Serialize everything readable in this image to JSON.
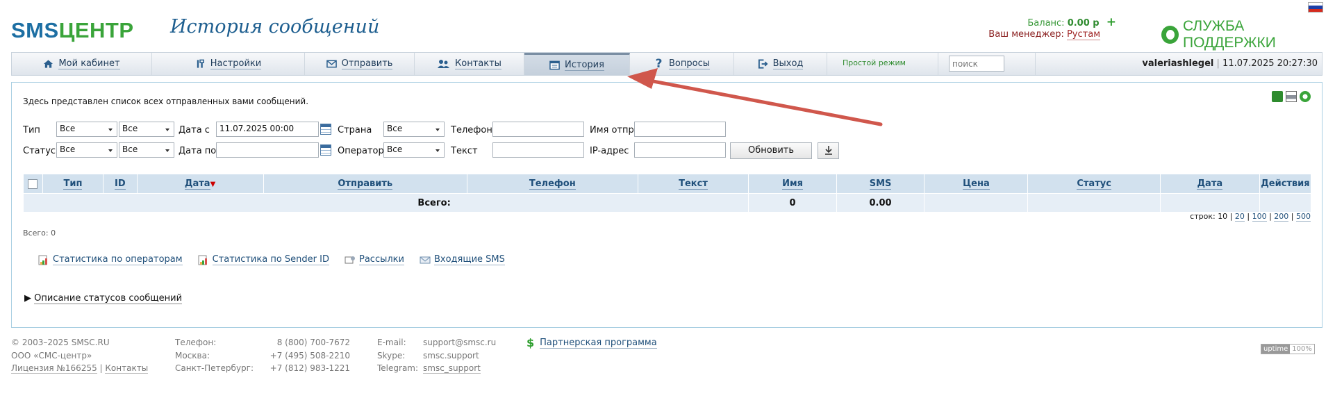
{
  "header": {
    "logo_sms": "SMS",
    "logo_centr": "ЦЕНТР",
    "title": "История сообщений",
    "balance_label": "Баланс:",
    "balance_value": "0.00 р",
    "balance_add": "+",
    "manager_label": "Ваш менеджер:",
    "manager_name": "Рустам",
    "support": "СЛУЖБА ПОДДЕРЖКИ"
  },
  "nav": {
    "items": [
      {
        "label": "Мой кабинет"
      },
      {
        "label": "Настройки"
      },
      {
        "label": "Отправить"
      },
      {
        "label": "Контакты"
      },
      {
        "label": "История"
      },
      {
        "label": "Вопросы"
      },
      {
        "label": "Выход"
      }
    ],
    "simple_mode": "Простой режим",
    "search_placeholder": "поиск",
    "username": "valeriashlegel",
    "datetime": "11.07.2025 20:27:30"
  },
  "panel": {
    "intro": "Здесь представлен список всех отправленных вами сообщений."
  },
  "filters": {
    "type_label": "Тип",
    "type_value": "Все",
    "type_value2": "Все",
    "date_from_label": "Дата с",
    "date_from_value": "11.07.2025 00:00",
    "country_label": "Страна",
    "country_value": "Все",
    "phone_label": "Телефон",
    "sender_label": "Имя отпр.",
    "status_label": "Статус",
    "status_value": "Все",
    "status_value2": "Все",
    "date_to_label": "Дата по",
    "operator_label": "Оператор",
    "operator_value": "Все",
    "text_label": "Текст",
    "ip_label": "IP-адрес",
    "refresh_button": "Обновить"
  },
  "table": {
    "columns": [
      "Тип",
      "ID",
      "Дата",
      "Отправить",
      "Телефон",
      "Текст",
      "Имя",
      "SMS",
      "Цена",
      "Статус",
      "Дата",
      "Действия"
    ],
    "total_label": "Всего:",
    "total_sms": "0",
    "total_price": "0.00"
  },
  "rows_per_page": {
    "label": "строк:",
    "current": "10",
    "options": [
      "20",
      "100",
      "200",
      "500"
    ]
  },
  "total_count": "Всего: 0",
  "links": [
    {
      "label": "Статистика по операторам"
    },
    {
      "label": "Статистика по Sender ID"
    },
    {
      "label": "Рассылки"
    },
    {
      "label": "Входящие SMS"
    }
  ],
  "status_desc": "Описание статусов сообщений",
  "footer": {
    "copyright": "© 2003–2025 SMSC.RU",
    "company": "ООО «СМС-центр»",
    "license": "Лицензия №166255",
    "contacts": "Контакты",
    "phone_label": "Телефон:",
    "phone_value": "8 (800) 700-7672",
    "moscow_label": "Москва:",
    "moscow_value": "+7 (495) 508-2210",
    "spb_label": "Санкт-Петербург:",
    "spb_value": "+7 (812) 983-1221",
    "email_label": "E-mail:",
    "email_value": "support@smsc.ru",
    "skype_label": "Skype:",
    "skype_value": "smsc.support",
    "telegram_label": "Telegram:",
    "telegram_value": "smsc_support",
    "partner": "Партнерская программа",
    "uptime_key": "uptime",
    "uptime_value": "100%"
  },
  "colors": {
    "brand_blue": "#1d6fa3",
    "brand_green": "#3aa43a",
    "arrow": "#d9534f"
  }
}
